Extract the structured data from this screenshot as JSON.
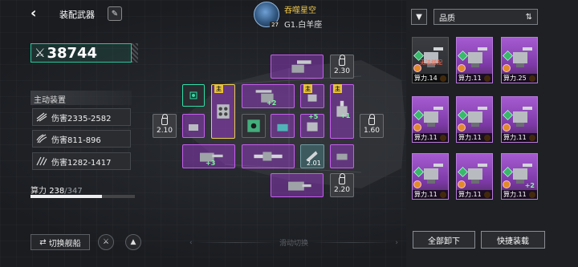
{
  "header": {
    "back_icon": "back-arrow-icon",
    "title": "装配武器",
    "edit_icon": "pen-icon",
    "player_name": "吞噬星空",
    "player_rank": "G1.白羊座",
    "player_level": "27"
  },
  "left": {
    "power": "38744",
    "section_title": "主动装置",
    "damage_rows": [
      {
        "icon": "claw-icon",
        "text": "伤害2335-2582"
      },
      {
        "icon": "triple-claw-icon",
        "text": "伤害811-896"
      },
      {
        "icon": "triple-slash-icon",
        "text": "伤害1282-1417"
      }
    ],
    "capacity_label": "算力",
    "capacity_current": "238",
    "capacity_max": "/347",
    "capacity_fraction": 0.686,
    "switch_ship": "切换舰船",
    "slide_hint": "滑动切换"
  },
  "slots": {
    "lock_top": "2.30",
    "lock_left": "2.10",
    "lock_right": "1.60",
    "lock_bottom": "2.20",
    "teal_value": "2.01",
    "main_tag": "主",
    "plus": [
      "+2",
      "+5",
      "+1",
      "+3"
    ]
  },
  "right": {
    "sort_label": "品质",
    "cards": [
      {
        "label": "算力.14",
        "warn": "无法搭配"
      },
      {
        "label": "算力.11"
      },
      {
        "label": "算力.25"
      },
      {
        "label": "算力.11"
      },
      {
        "label": "算力.11"
      },
      {
        "label": "算力.11"
      },
      {
        "label": "算力.11"
      },
      {
        "label": "算力.11"
      },
      {
        "label": "算力.11",
        "plus": "+2"
      }
    ],
    "unequip_all": "全部卸下",
    "quick_equip": "快捷装载"
  },
  "colors": {
    "accent_green": "#26c79b",
    "purple_slot": "#c65df0",
    "main_gold": "#e9c23b",
    "player_name": "#f2c84b"
  }
}
